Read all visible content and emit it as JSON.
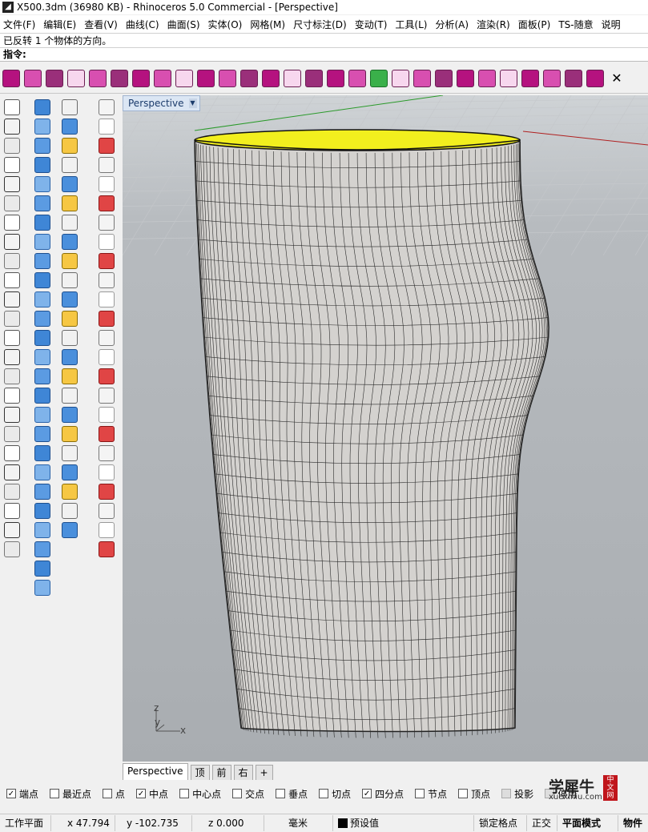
{
  "window": {
    "title": "X500.3dm (36980 KB) - Rhinoceros 5.0 Commercial - [Perspective]"
  },
  "menu": [
    "文件(F)",
    "编辑(E)",
    "查看(V)",
    "曲线(C)",
    "曲面(S)",
    "实体(O)",
    "网格(M)",
    "尺寸标注(D)",
    "变动(T)",
    "工具(L)",
    "分析(A)",
    "渲染(R)",
    "面板(P)",
    "TS-随意",
    "说明"
  ],
  "command": {
    "history": "已反转 1 个物体的方向。",
    "prompt": "指令:"
  },
  "viewport": {
    "label": "Perspective",
    "dropdown": "▼",
    "axes": {
      "z": "z",
      "y": "y",
      "x": "x"
    }
  },
  "view_tabs": [
    "Perspective",
    "顶",
    "前",
    "右",
    "+"
  ],
  "osnaps": [
    {
      "label": "端点",
      "checked": true
    },
    {
      "label": "最近点",
      "checked": false
    },
    {
      "label": "点",
      "checked": false
    },
    {
      "label": "中点",
      "checked": true
    },
    {
      "label": "中心点",
      "checked": false
    },
    {
      "label": "交点",
      "checked": false
    },
    {
      "label": "垂点",
      "checked": false
    },
    {
      "label": "切点",
      "checked": false
    },
    {
      "label": "四分点",
      "checked": true
    },
    {
      "label": "节点",
      "checked": false
    },
    {
      "label": "顶点",
      "checked": false
    },
    {
      "label": "投影",
      "checked": false
    },
    {
      "label": "停用",
      "checked": false
    }
  ],
  "status": {
    "cplane": "工作平面",
    "x": "x 47.794",
    "y": "y -102.735",
    "z": "z 0.000",
    "units": "毫米",
    "layer": "预设值",
    "grid_snap": "锁定格点",
    "ortho": "正交",
    "planar": "平面模式",
    "object_snap": "物件"
  },
  "watermark": {
    "text": "学犀牛",
    "url": "xuexiniu.com",
    "badge": "中文网"
  },
  "colors": {
    "accent": "#b5127f",
    "model_top": "#f2ef1e",
    "model_surface": "#d4d2cf",
    "viewport_bg": "#aeb2b6"
  }
}
